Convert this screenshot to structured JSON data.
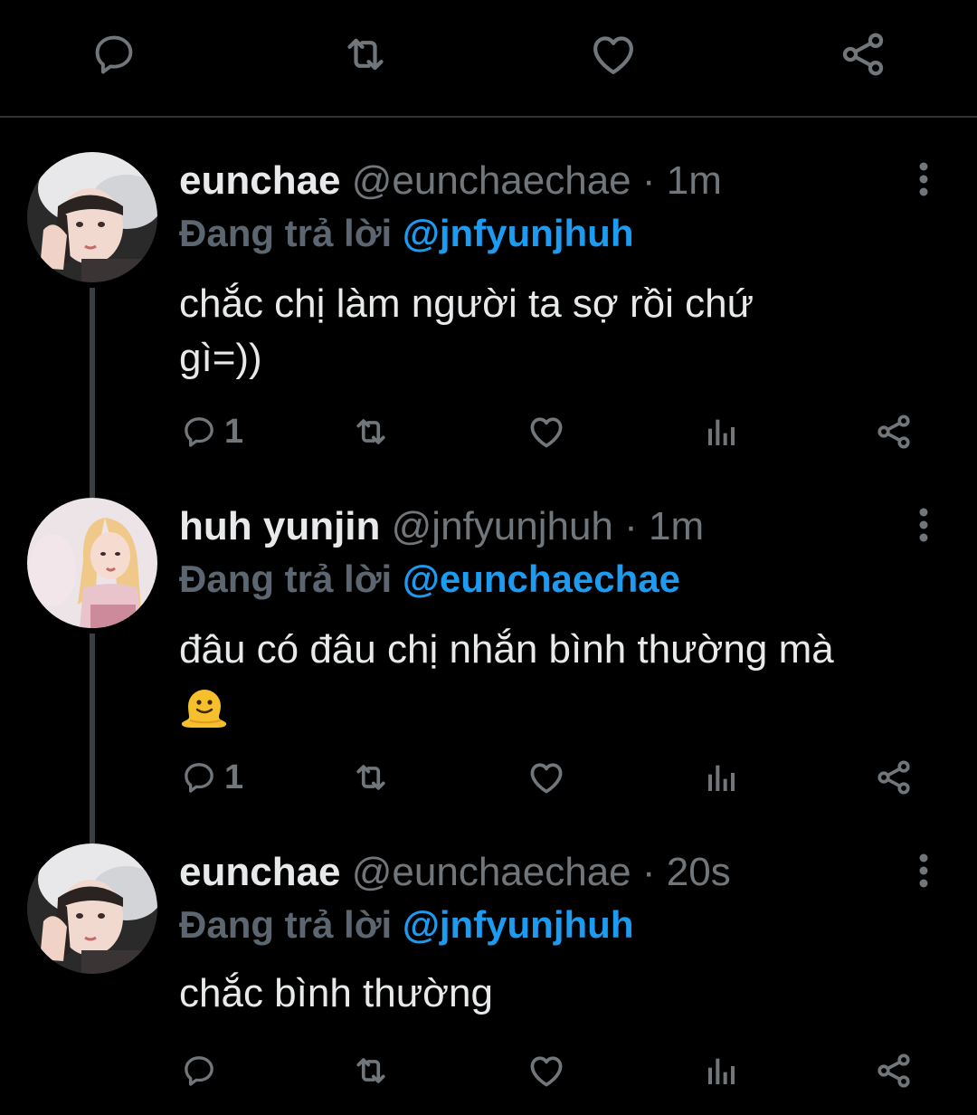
{
  "top_actions": {
    "icons": [
      "reply-icon",
      "retweet-icon",
      "like-icon",
      "share-icon"
    ]
  },
  "tweets": [
    {
      "name": "eunchae",
      "handle": "@eunchaechae",
      "separator": "·",
      "time": "1m",
      "reply_prefix": "Đang trả lời",
      "reply_to": "@jnfyunjhuh",
      "text_line1": "chắc chị làm người ta sợ rồi chứ",
      "text_line2": "gì=))",
      "reply_count": "1"
    },
    {
      "name": "huh yunjin",
      "handle": "@jnfyunjhuh",
      "separator": "·",
      "time": "1m",
      "reply_prefix": "Đang trả lời",
      "reply_to": "@eunchaechae",
      "text_line1": "đâu có đâu chị nhắn bình thường mà",
      "text_emoji": "melting-face-emoji",
      "reply_count": "1"
    },
    {
      "name": "eunchae",
      "handle": "@eunchaechae",
      "separator": "·",
      "time": "20s",
      "reply_prefix": "Đang trả lời",
      "reply_to": "@jnfyunjhuh",
      "text_line1": "chắc bình thường",
      "reply_count": ""
    }
  ],
  "colors": {
    "background": "#000000",
    "text": "#e7e9ea",
    "muted": "#71767b",
    "mention": "#1d9bf0",
    "reply_prefix": "#5b6670"
  }
}
